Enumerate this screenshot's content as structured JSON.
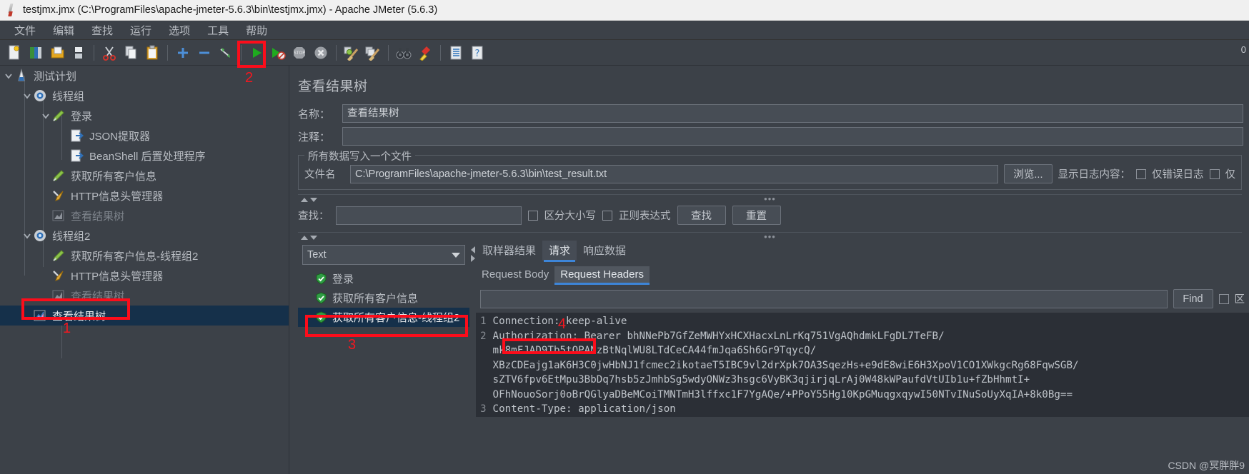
{
  "window": {
    "title": "testjmx.jmx (C:\\ProgramFiles\\apache-jmeter-5.6.3\\bin\\testjmx.jmx) - Apache JMeter (5.6.3)",
    "logo_icon": "jmeter-feather-icon"
  },
  "menubar": {
    "items": [
      {
        "label": "文件",
        "name": "menu-file"
      },
      {
        "label": "编辑",
        "name": "menu-edit"
      },
      {
        "label": "查找",
        "name": "menu-search"
      },
      {
        "label": "运行",
        "name": "menu-run"
      },
      {
        "label": "选项",
        "name": "menu-options"
      },
      {
        "label": "工具",
        "name": "menu-tools"
      },
      {
        "label": "帮助",
        "name": "menu-help"
      }
    ]
  },
  "toolbar": {
    "buttons": [
      {
        "icon": "new-document-icon",
        "name": "toolbar-new"
      },
      {
        "icon": "templates-icon",
        "name": "toolbar-templates"
      },
      {
        "icon": "open-folder-icon",
        "name": "toolbar-open"
      },
      {
        "icon": "save-icon",
        "name": "toolbar-save"
      },
      {
        "icon": "cut-scissors-icon",
        "name": "toolbar-cut"
      },
      {
        "icon": "copy-icon",
        "name": "toolbar-copy"
      },
      {
        "icon": "paste-clipboard-icon",
        "name": "toolbar-paste"
      },
      {
        "icon": "plus-expand-icon",
        "name": "toolbar-expand"
      },
      {
        "icon": "minus-collapse-icon",
        "name": "toolbar-collapse"
      },
      {
        "icon": "toggle-enable-icon",
        "name": "toolbar-toggle"
      },
      {
        "icon": "start-play-icon",
        "name": "toolbar-start"
      },
      {
        "icon": "start-no-pause-icon",
        "name": "toolbar-start-no-timers"
      },
      {
        "icon": "stop-icon",
        "name": "toolbar-stop"
      },
      {
        "icon": "shutdown-icon",
        "name": "toolbar-shutdown"
      },
      {
        "icon": "clear-icon",
        "name": "toolbar-clear"
      },
      {
        "icon": "clear-all-icon",
        "name": "toolbar-clear-all"
      },
      {
        "icon": "search-binoculars-icon",
        "name": "toolbar-search"
      },
      {
        "icon": "search-reset-broom-icon",
        "name": "toolbar-search-reset"
      },
      {
        "icon": "function-helper-icon",
        "name": "toolbar-function-helper"
      },
      {
        "icon": "help-icon",
        "name": "toolbar-help"
      }
    ],
    "status_right": "0"
  },
  "tree": {
    "nodes": [
      {
        "label": "测试计划",
        "icon": "test-plan-icon",
        "depth": 0,
        "twisty": "down",
        "state": "normal",
        "name": "tree-node-test-plan"
      },
      {
        "label": "线程组",
        "icon": "thread-group-icon",
        "depth": 1,
        "twisty": "down",
        "state": "normal",
        "name": "tree-node-thread-group"
      },
      {
        "label": "登录",
        "icon": "http-sampler-icon",
        "depth": 2,
        "twisty": "down",
        "state": "normal",
        "name": "tree-node-login"
      },
      {
        "label": "JSON提取器",
        "icon": "post-processor-icon",
        "depth": 3,
        "twisty": "none",
        "state": "normal",
        "name": "tree-node-json-extractor"
      },
      {
        "label": "BeanShell 后置处理程序",
        "icon": "post-processor-icon",
        "depth": 3,
        "twisty": "none",
        "state": "normal",
        "name": "tree-node-beanshell-postprocessor"
      },
      {
        "label": "获取所有客户信息",
        "icon": "http-sampler-icon",
        "depth": 2,
        "twisty": "none",
        "state": "normal",
        "name": "tree-node-get-all-customers"
      },
      {
        "label": "HTTP信息头管理器",
        "icon": "header-manager-icon",
        "depth": 2,
        "twisty": "none",
        "state": "normal",
        "name": "tree-node-http-header-manager-1"
      },
      {
        "label": "查看结果树",
        "icon": "view-results-tree-icon",
        "depth": 2,
        "twisty": "none",
        "state": "disabled",
        "name": "tree-node-view-results-tree-1"
      },
      {
        "label": "线程组2",
        "icon": "thread-group-icon",
        "depth": 1,
        "twisty": "down",
        "state": "normal",
        "name": "tree-node-thread-group-2"
      },
      {
        "label": "获取所有客户信息-线程组2",
        "icon": "http-sampler-icon",
        "depth": 2,
        "twisty": "none",
        "state": "normal",
        "name": "tree-node-get-all-customers-tg2"
      },
      {
        "label": "HTTP信息头管理器",
        "icon": "header-manager-icon",
        "depth": 2,
        "twisty": "none",
        "state": "normal",
        "name": "tree-node-http-header-manager-2"
      },
      {
        "label": "查看结果树",
        "icon": "view-results-tree-icon",
        "depth": 2,
        "twisty": "none",
        "state": "disabled",
        "name": "tree-node-view-results-tree-2"
      },
      {
        "label": "查看结果树",
        "icon": "view-results-tree-icon",
        "depth": 1,
        "twisty": "none",
        "state": "selected",
        "name": "tree-node-view-results-tree-selected"
      }
    ]
  },
  "panel": {
    "title": "查看结果树",
    "name_label": "名称：",
    "name_value": "查看结果树",
    "comment_label": "注释：",
    "comment_value": "",
    "file_group_legend": "所有数据写入一个文件",
    "filename_label": "文件名",
    "filename_value": "C:\\ProgramFiles\\apache-jmeter-5.6.3\\bin\\test_result.txt",
    "browse_button": "浏览...",
    "log_display_label": "显示日志内容：",
    "errors_only_label": "仅错误日志",
    "successes_only_label": "仅",
    "search_label": "查找：",
    "search_value": "",
    "case_sensitive_label": "区分大小写",
    "regex_label": "正则表达式",
    "search_button": "查找",
    "reset_button": "重置",
    "splitter_dots": "•••"
  },
  "results": {
    "renderer_selected": "Text",
    "items": [
      {
        "label": "登录",
        "icon": "success-shield-icon",
        "selected": false,
        "name": "result-item-login"
      },
      {
        "label": "获取所有客户信息",
        "icon": "success-shield-icon",
        "selected": false,
        "name": "result-item-get-all-customers"
      },
      {
        "label": "获取所有客户信息-线程组2",
        "icon": "success-shield-icon",
        "selected": true,
        "name": "result-item-get-all-customers-tg2"
      }
    ]
  },
  "detail": {
    "tabs": [
      {
        "label": "取样器结果",
        "active": false,
        "name": "tab-sampler-result"
      },
      {
        "label": "请求",
        "active": true,
        "name": "tab-request"
      },
      {
        "label": "响应数据",
        "active": false,
        "name": "tab-response-data"
      }
    ],
    "subtabs": [
      {
        "label": "Request Body",
        "active": false,
        "name": "subtab-request-body"
      },
      {
        "label": "Request Headers",
        "active": true,
        "name": "subtab-request-headers"
      }
    ],
    "find_input_value": "",
    "find_button": "Find",
    "case_checkbox_label": "区",
    "code_lines": [
      {
        "n": "1",
        "text": "Connection: keep-alive"
      },
      {
        "n": "2",
        "text": "Authorization: Bearer bhNNePb7GfZeMWHYxHCXHacxLnLrKq751VgAQhdmkLFgDL7TeFB/"
      },
      {
        "n": "",
        "text": "mk8mFJAD9Tb5tOPANzBtNqlWU8LTdCeCA44fmJqa6Sh6Gr9TqycQ/"
      },
      {
        "n": "",
        "text": "XBzCDEajg1aK6H3C0jwHbNJ1fcmec2ikotaeT5IBC9vl2drXpk7OA3SqezHs+e9dE8wiE6H3XpoV1CO1XWkgcRg68FqwSGB/"
      },
      {
        "n": "",
        "text": "sZTV6fpv6EtMpu3BbDq7hsb5zJmhbSg5wdyONWz3hsgc6VyBK3qjirjqLrAj0W48kWPaufdVtUIb1u+fZbHhmtI+"
      },
      {
        "n": "",
        "text": "OFhNouoSorj0oBrQGlyaDBeMCoiTMNTmH3lffxc1F7YgAQe/+PPoY55Hg10KpGMuqgxqywI50NTvINuSoUyXqIA+8k0Bg=="
      },
      {
        "n": "3",
        "text": "Content-Type: application/json"
      }
    ]
  },
  "annotations": {
    "markers": [
      {
        "number": "2",
        "name": "annotation-marker-2"
      },
      {
        "number": "1",
        "name": "annotation-marker-1"
      },
      {
        "number": "3",
        "name": "annotation-marker-3"
      },
      {
        "number": "4",
        "name": "annotation-marker-4"
      }
    ],
    "accent_color": "#fc0d1b"
  },
  "watermark": {
    "text": "CSDN @冥胖胖9"
  }
}
